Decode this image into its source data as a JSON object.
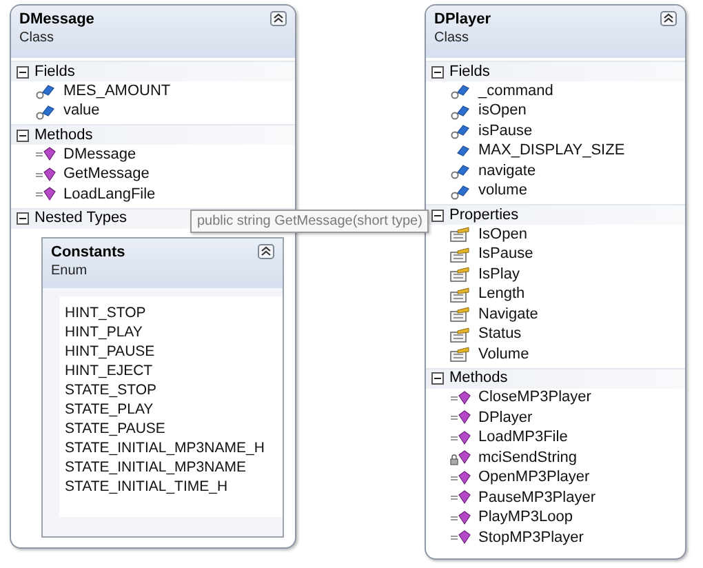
{
  "classes": [
    {
      "name": "DMessage",
      "kind_label": "Class",
      "expanded": true,
      "sections": [
        {
          "title": "Fields",
          "expanded": true,
          "members": [
            {
              "name": "MES_AMOUNT",
              "kind": "field"
            },
            {
              "name": "value",
              "kind": "field"
            }
          ]
        },
        {
          "title": "Methods",
          "expanded": true,
          "members": [
            {
              "name": "DMessage",
              "kind": "method"
            },
            {
              "name": "GetMessage",
              "kind": "method"
            },
            {
              "name": "LoadLangFile",
              "kind": "method"
            }
          ]
        },
        {
          "title": "Nested Types",
          "expanded": true,
          "nested": [
            {
              "name": "Constants",
              "kind_label": "Enum",
              "expanded": true,
              "values": [
                "HINT_STOP",
                "HINT_PLAY",
                "HINT_PAUSE",
                "HINT_EJECT",
                "STATE_STOP",
                "STATE_PLAY",
                "STATE_PAUSE",
                "STATE_INITIAL_MP3NAME_H",
                "STATE_INITIAL_MP3NAME",
                "STATE_INITIAL_TIME_H"
              ]
            }
          ]
        }
      ]
    },
    {
      "name": "DPlayer",
      "kind_label": "Class",
      "expanded": true,
      "sections": [
        {
          "title": "Fields",
          "expanded": true,
          "members": [
            {
              "name": "_command",
              "kind": "field"
            },
            {
              "name": "isOpen",
              "kind": "field"
            },
            {
              "name": "isPause",
              "kind": "field"
            },
            {
              "name": "MAX_DISPLAY_SIZE",
              "kind": "constant"
            },
            {
              "name": "navigate",
              "kind": "field"
            },
            {
              "name": "volume",
              "kind": "field"
            }
          ]
        },
        {
          "title": "Properties",
          "expanded": true,
          "members": [
            {
              "name": "IsOpen",
              "kind": "property"
            },
            {
              "name": "IsPause",
              "kind": "property"
            },
            {
              "name": "IsPlay",
              "kind": "property"
            },
            {
              "name": "Length",
              "kind": "property"
            },
            {
              "name": "Navigate",
              "kind": "property"
            },
            {
              "name": "Status",
              "kind": "property"
            },
            {
              "name": "Volume",
              "kind": "property"
            }
          ]
        },
        {
          "title": "Methods",
          "expanded": true,
          "members": [
            {
              "name": "CloseMP3Player",
              "kind": "method"
            },
            {
              "name": "DPlayer",
              "kind": "method"
            },
            {
              "name": "LoadMP3File",
              "kind": "method"
            },
            {
              "name": "mciSendString",
              "kind": "private_method"
            },
            {
              "name": "OpenMP3Player",
              "kind": "method"
            },
            {
              "name": "PauseMP3Player",
              "kind": "method"
            },
            {
              "name": "PlayMP3Loop",
              "kind": "method"
            },
            {
              "name": "StopMP3Player",
              "kind": "method"
            }
          ]
        }
      ]
    }
  ],
  "tooltip": {
    "text": "public string GetMessage(short type)"
  }
}
